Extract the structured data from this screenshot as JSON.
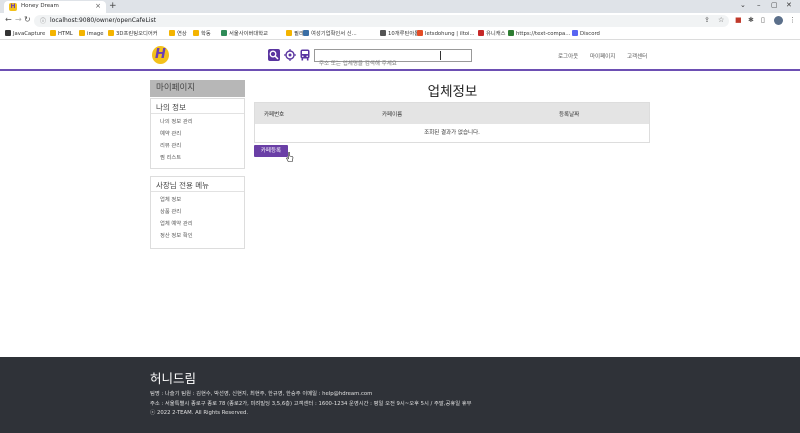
{
  "browser": {
    "tab_title": "Honey Dream",
    "url": "localhost:9080/owner/openCafeList",
    "bookmarks": [
      {
        "label": "JavaCapture",
        "color": "#333333"
      },
      {
        "label": "HTML",
        "color": "#f4b400"
      },
      {
        "label": "image",
        "color": "#f4b400"
      },
      {
        "label": "3D프린팅오디어커",
        "color": "#f4b400"
      },
      {
        "label": "연상",
        "color": "#f4b400"
      },
      {
        "label": "학동",
        "color": "#f4b400"
      },
      {
        "label": "서울사이버대학교",
        "color": "#2e8b57"
      },
      {
        "label": "필라",
        "color": "#f4b400"
      },
      {
        "label": "여성기업확인서 신...",
        "color": "#3a6ea5"
      },
      {
        "label": "10개루틴아톰",
        "color": "#555555"
      },
      {
        "label": "letsdohung | iltoi...",
        "color": "#e44d26"
      },
      {
        "label": "유니캐스",
        "color": "#c62828"
      },
      {
        "label": "https://text-compa...",
        "color": "#2e7d32"
      },
      {
        "label": "Discord",
        "color": "#5865f2"
      }
    ]
  },
  "header": {
    "logo_text": "H",
    "search_placeholder": "주소 또는 업체명을 검색해 주세요",
    "links": [
      "로그아웃",
      "마이페이지",
      "고객센터"
    ],
    "accent_color": "#6d4fb3"
  },
  "sidebar": {
    "title": "마이페이지",
    "groups": [
      {
        "title": "나의 정보",
        "items": [
          "나의 정보 관리",
          "예약 관리",
          "리뷰 관리",
          "찜 리스트"
        ]
      },
      {
        "title": "사장님 전용 메뉴",
        "items": [
          "업체 정보",
          "상품 관리",
          "업체 예약 관리",
          "정산 정보 확인"
        ]
      }
    ]
  },
  "main": {
    "title": "업체정보",
    "table": {
      "columns": [
        "카페번호",
        "카페이름",
        "등록날짜"
      ],
      "empty_message": "조회된 결과가 없습니다."
    },
    "register_button": "카페등록"
  },
  "footer": {
    "brand": "허니드림",
    "line1": "팀명 : 나슬기     팀원 : 김현수, 박선영, 신현지, 최현주, 한규영, 한승주     이메일 : help@hdream.com",
    "line2": "주소 : 서울특별시 종로구 종로 78 (종로2가, 미려빌딩 3,5,6층)     고객센터 : 1600-1234     운영시간 : 평일 오전 9시~오후 5시 / 주말,공휴일 휴무",
    "line3": "ⓒ 2022 2-TEAM. All Rights Reserved."
  }
}
